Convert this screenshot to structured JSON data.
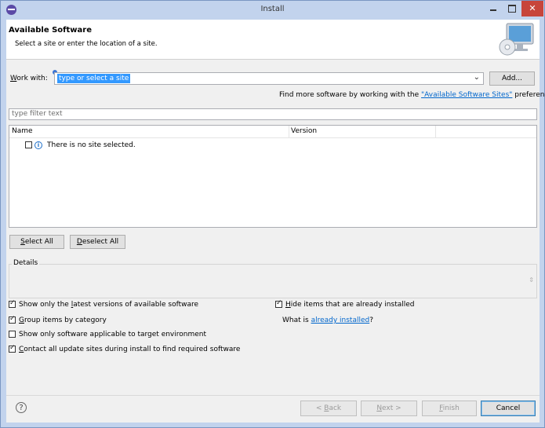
{
  "window": {
    "title": "Install",
    "close_glyph": "✕"
  },
  "banner": {
    "title": "Available Software",
    "subtitle": "Select a site or enter the location of a site."
  },
  "work_with": {
    "label": "Work with:",
    "value": "type or select a site",
    "add_button": "Add...",
    "find_more_prefix": "Find more software by working with the ",
    "find_more_link": "\"Available Software Sites\"",
    "find_more_suffix": " preferences."
  },
  "filter": {
    "placeholder": "type filter text"
  },
  "table": {
    "columns": [
      "Name",
      "Version"
    ],
    "rows": [
      {
        "checked": false,
        "icon": "info-icon",
        "text": "There is no site selected."
      }
    ]
  },
  "select_buttons": {
    "select_all": "Select All",
    "deselect_all": "Deselect All"
  },
  "details": {
    "label": "Details"
  },
  "options": {
    "show_latest": {
      "label": "Show only the latest versions of available software",
      "checked": true
    },
    "group_by_category": {
      "label": "Group items by category",
      "checked": true
    },
    "show_applicable": {
      "label": "Show only software applicable to target environment",
      "checked": false
    },
    "contact_sites": {
      "label": "Contact all update sites during install to find required software",
      "checked": true
    },
    "hide_installed": {
      "label": "Hide items that are already installed",
      "checked": true
    },
    "what_is_prefix": "What is ",
    "what_is_link": "already installed",
    "what_is_suffix": "?"
  },
  "footer": {
    "back": "< Back",
    "next": "Next >",
    "finish": "Finish",
    "cancel": "Cancel",
    "help_glyph": "?"
  },
  "colors": {
    "accent": "#3399ff",
    "link": "#0066cc",
    "close_button": "#c7453b",
    "frame": "#c2d3ed"
  }
}
